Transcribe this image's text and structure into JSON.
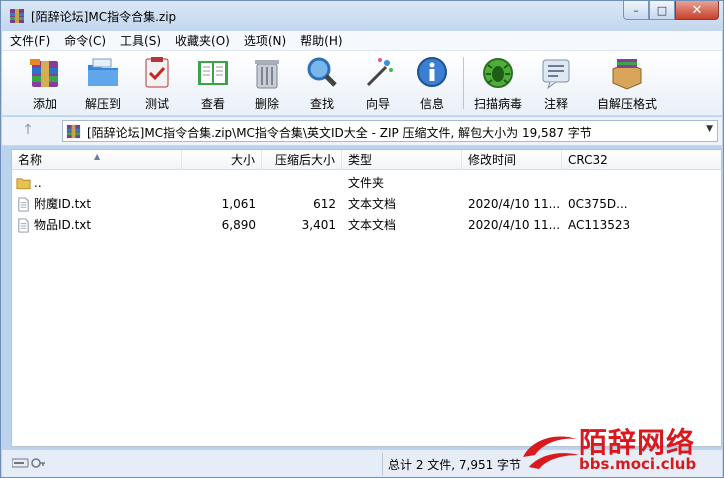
{
  "window": {
    "title": "[陌辞论坛]MC指令合集.zip",
    "controls": {
      "minimize": "–",
      "maximize": "□",
      "close": "✕"
    }
  },
  "menu": [
    "文件(F)",
    "命令(C)",
    "工具(S)",
    "收藏夹(O)",
    "选项(N)",
    "帮助(H)"
  ],
  "toolbar": [
    {
      "label": "添加",
      "icon": "add-archive-icon"
    },
    {
      "label": "解压到",
      "icon": "extract-to-icon"
    },
    {
      "label": "测试",
      "icon": "test-icon"
    },
    {
      "label": "查看",
      "icon": "view-book-icon"
    },
    {
      "label": "删除",
      "icon": "trash-icon"
    },
    {
      "label": "查找",
      "icon": "magnifier-icon"
    },
    {
      "label": "向导",
      "icon": "wizard-wand-icon"
    },
    {
      "label": "信息",
      "icon": "info-icon"
    },
    {
      "label": "扫描病毒",
      "icon": "virus-scan-icon"
    },
    {
      "label": "注释",
      "icon": "comment-icon"
    },
    {
      "label": "自解压格式",
      "icon": "sfx-box-icon"
    }
  ],
  "address": {
    "up": "↑",
    "path": "[陌辞论坛]MC指令合集.zip\\MC指令合集\\英文ID大全 - ZIP 压缩文件, 解包大小为 19,587 字节"
  },
  "columns": {
    "name": "名称",
    "size": "大小",
    "packed": "压缩后大小",
    "type": "类型",
    "modified": "修改时间",
    "crc": "CRC32"
  },
  "rows": [
    {
      "name": "..",
      "size": "",
      "packed": "",
      "type": "文件夹",
      "modified": "",
      "crc": "",
      "icon": "folder-icon"
    },
    {
      "name": "附魔ID.txt",
      "size": "1,061",
      "packed": "612",
      "type": "文本文档",
      "modified": "2020/4/10 11...",
      "crc": "0C375D...",
      "icon": "text-file-icon"
    },
    {
      "name": "物品ID.txt",
      "size": "6,890",
      "packed": "3,401",
      "type": "文本文档",
      "modified": "2020/4/10 11...",
      "crc": "AC113523",
      "icon": "text-file-icon"
    }
  ],
  "status": {
    "summary": "总计 2 文件, 7,951 字节"
  },
  "watermark": {
    "title": "陌辞网络",
    "url": "bbs.moci.club"
  },
  "colors": {
    "accent": "#d8191e",
    "frame": "#bcd3ee"
  }
}
